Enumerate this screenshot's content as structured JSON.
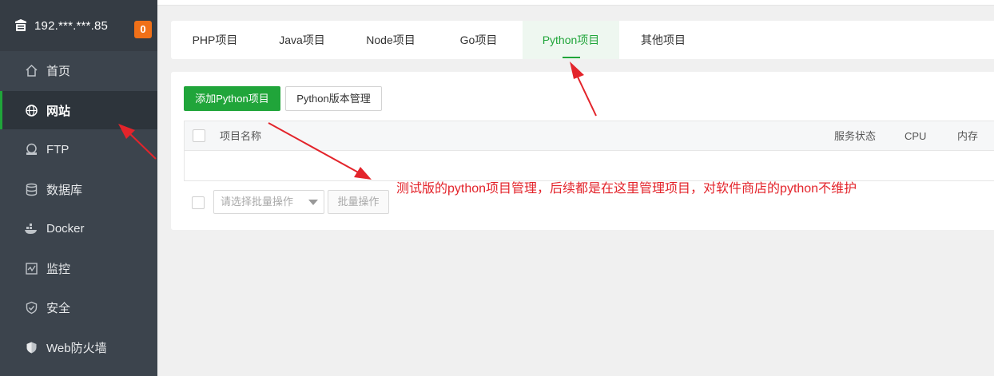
{
  "sidebar": {
    "server_name": "192.***.***.85",
    "badge_count": "0",
    "items": [
      {
        "label": "首页",
        "icon": "home-icon"
      },
      {
        "label": "网站",
        "icon": "globe-icon"
      },
      {
        "label": "FTP",
        "icon": "ftp-icon"
      },
      {
        "label": "数据库",
        "icon": "database-icon"
      },
      {
        "label": "Docker",
        "icon": "docker-icon"
      },
      {
        "label": "监控",
        "icon": "monitor-icon"
      },
      {
        "label": "安全",
        "icon": "shield-check-icon"
      },
      {
        "label": "Web防火墙",
        "icon": "shield-icon"
      }
    ],
    "active_index": 1
  },
  "tabs": [
    {
      "label": "PHP项目"
    },
    {
      "label": "Java项目"
    },
    {
      "label": "Node项目"
    },
    {
      "label": "Go项目"
    },
    {
      "label": "Python项目"
    },
    {
      "label": "其他项目"
    }
  ],
  "active_tab_index": 4,
  "toolbar": {
    "add_label": "添加Python项目",
    "version_label": "Python版本管理"
  },
  "table": {
    "columns": [
      "项目名称",
      "服务状态",
      "CPU",
      "内存"
    ],
    "rows": []
  },
  "batch": {
    "select_placeholder": "请选择批量操作",
    "button_label": "批量操作"
  },
  "annotation": "测试版的python项目管理，后续都是在这里管理项目，对软件商店的python不维护",
  "colors": {
    "accent": "#20a53a",
    "sidebar_bg": "#3c444d",
    "badge": "#f07018",
    "annotation": "#e3242b"
  }
}
